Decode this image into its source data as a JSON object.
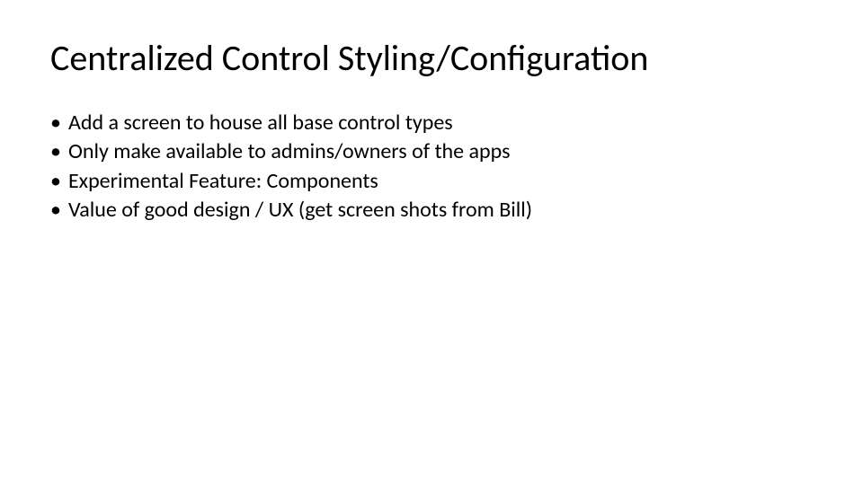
{
  "slide": {
    "title": "Centralized Control Styling/Configuration",
    "bullets": [
      "Add a screen to house all base control types",
      "Only make available to admins/owners of the apps",
      "Experimental Feature: Components",
      "Value of good design / UX (get screen shots from Bill)"
    ]
  }
}
